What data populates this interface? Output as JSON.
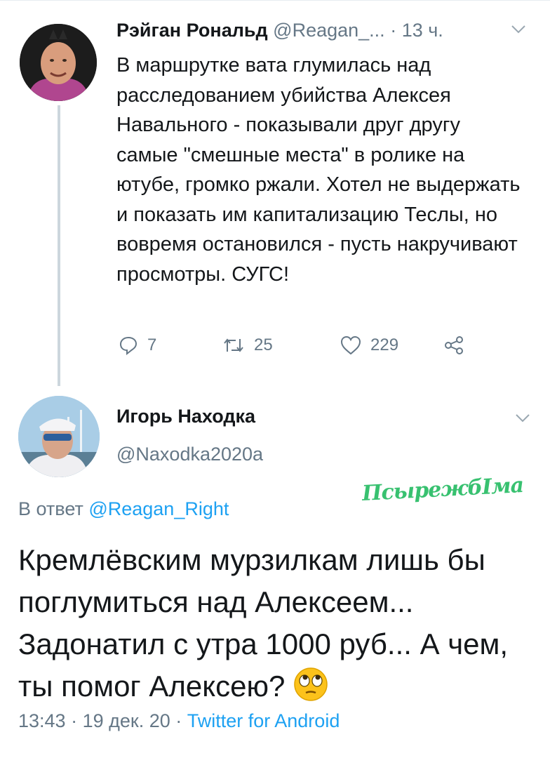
{
  "tweet1": {
    "name": "Рэйган Рональд",
    "handle": "@Reagan_...",
    "separator": "·",
    "time": "13 ч.",
    "text": "В маршрутке вата глумилась над расследованием убийства Алексея Навального - показывали друг другу самые \"смешные места\" в ролике на ютубе, громко ржали. Хотел не выдержать и показать им капитализацию Теслы, но вовремя остановился - пусть накручивают просмотры. СУГС!",
    "replies": "7",
    "retweets": "25",
    "likes": "229",
    "icons": [
      "reply-icon",
      "retweet-icon",
      "like-icon",
      "share-icon",
      "chevron-down-icon"
    ]
  },
  "tweet2": {
    "name": "Игорь Находка",
    "handle": "@Naxodka2020a",
    "reply_prefix": "В ответ ",
    "reply_to": "@Reagan_Right",
    "text": "Кремлёвским мурзилкам лишь бы поглумиться над Алексеем... Задонатил с утра 1000 руб... А чем, ты помог Алексею?",
    "emoji": "rolling-eyes-emoji",
    "time": "13:43",
    "date": "19 дек. 20",
    "sep": " · ",
    "app": "Twitter for Android"
  },
  "watermark": "ПсырежбIма",
  "colors": {
    "link": "#1da1f2",
    "secondary": "#657786",
    "watermark": "#38c170"
  }
}
